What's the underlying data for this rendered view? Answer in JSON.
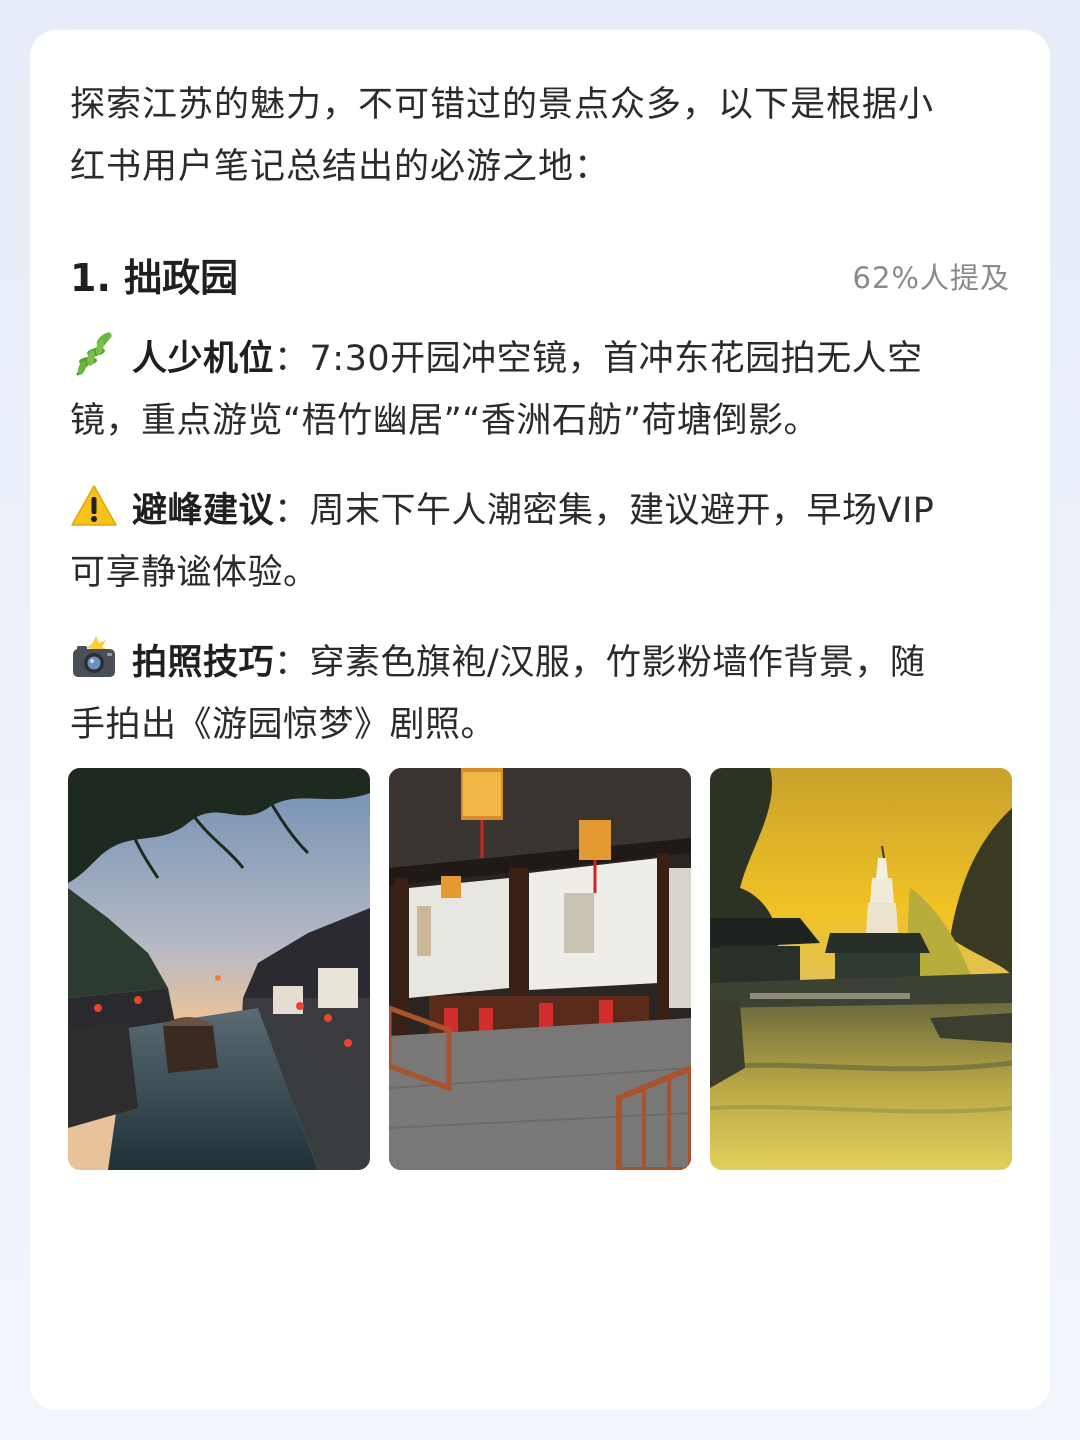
{
  "intro_line1": "探索江苏的魅力，不可错过的景点众多，以下是根据小",
  "intro_line2": "红书用户笔记总结出的必游之地：",
  "heading": "1. 拙政园",
  "mention": "62%人提及",
  "tips": [
    {
      "icon": "herb-icon",
      "label": "人少机位",
      "colon": "：",
      "line1": "7:30开园冲空镜，首冲东花园拍无人空",
      "line2": "镜，重点游览“梧竹幽居”“香洲石舫”荷塘倒影。"
    },
    {
      "icon": "warning-icon",
      "label": "避峰建议",
      "colon": "：",
      "line1": "周末下午人潮密集，建议避开，早场VIP",
      "line2": "可享静谧体验。"
    },
    {
      "icon": "camera-flash-icon",
      "label": "拍照技巧",
      "colon": "：",
      "line1": "穿素色旗袍/汉服，竹影粉墙作背景，随",
      "line2": "手拍出《游园惊梦》剧照。"
    }
  ],
  "photos": [
    {
      "name": "canal-town-dusk-photo"
    },
    {
      "name": "garden-hall-interior-photo"
    },
    {
      "name": "pagoda-pond-sunset-photo"
    }
  ]
}
